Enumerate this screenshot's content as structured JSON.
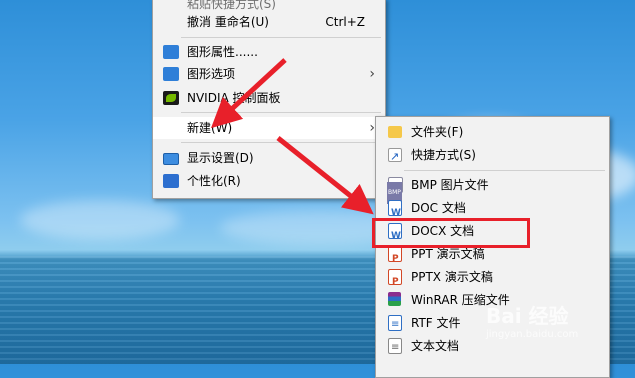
{
  "context_menu": {
    "items": [
      {
        "label": "粘贴快捷方式(S)",
        "accel": ""
      },
      {
        "label": "撤消 重命名(U)",
        "accel": "Ctrl+Z"
      },
      {
        "label": "图形属性......",
        "accel": ""
      },
      {
        "label": "图形选项",
        "accel": ""
      },
      {
        "label": "NVIDIA 控制面板",
        "accel": ""
      },
      {
        "label": "新建(W)",
        "accel": ""
      },
      {
        "label": "显示设置(D)",
        "accel": ""
      },
      {
        "label": "个性化(R)",
        "accel": ""
      }
    ]
  },
  "new_submenu": {
    "items": [
      {
        "label": "文件夹(F)"
      },
      {
        "label": "快捷方式(S)"
      },
      {
        "label": "BMP 图片文件"
      },
      {
        "label": "DOC 文档"
      },
      {
        "label": "DOCX 文档"
      },
      {
        "label": "PPT 演示文稿"
      },
      {
        "label": "PPTX 演示文稿"
      },
      {
        "label": "WinRAR 压缩文件"
      },
      {
        "label": "RTF 文件"
      },
      {
        "label": "文本文档"
      }
    ]
  },
  "watermark": {
    "text": "Bai 经验",
    "sub": "jingyan.baidu.com"
  },
  "colors": {
    "annotation_red": "#e8202a",
    "menu_bg": "#f2f2f2"
  }
}
